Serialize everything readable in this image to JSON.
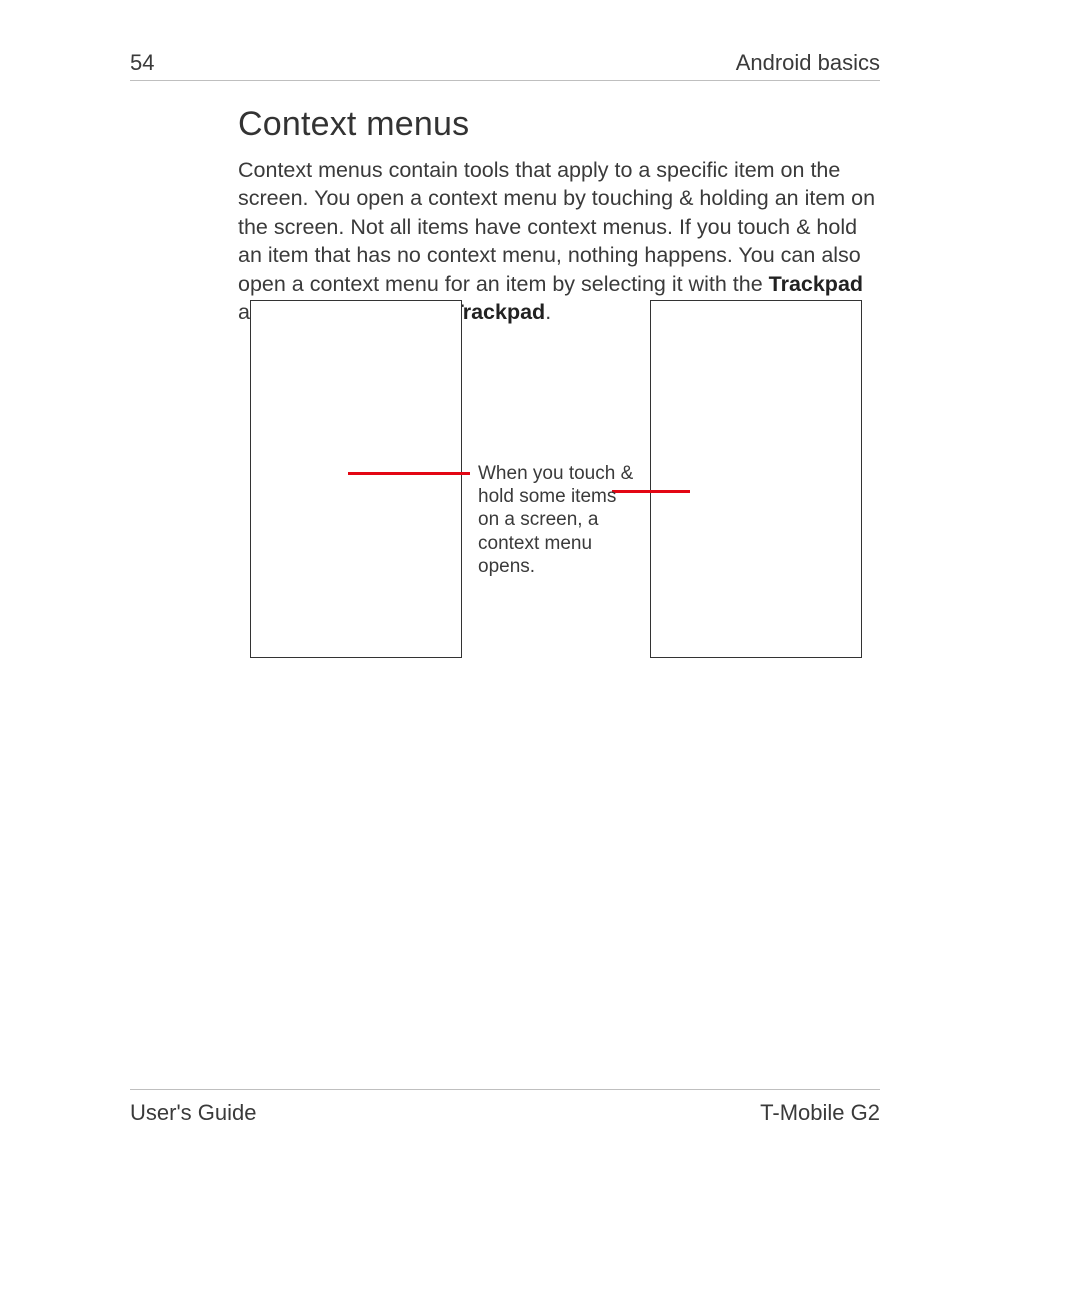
{
  "header": {
    "page_number": "54",
    "section": "Android basics"
  },
  "content": {
    "heading": "Context menus",
    "para_pre": "Context menus contain tools that apply to a specific item on the screen. You open a context menu by touching & holding an item on the screen. Not all items have context menus. If you touch & hold an item that has no context menu, nothing happens. You can also open a context menu for an item by selecting it with the ",
    "bold1": "Trackpad",
    "para_mid": " and then pressing the ",
    "bold2": "Trackpad",
    "para_post": "."
  },
  "callout": {
    "text": "When you touch & hold some items on a screen, a context menu opens."
  },
  "footer": {
    "left": "User's Guide",
    "right": "T-Mobile G2"
  }
}
